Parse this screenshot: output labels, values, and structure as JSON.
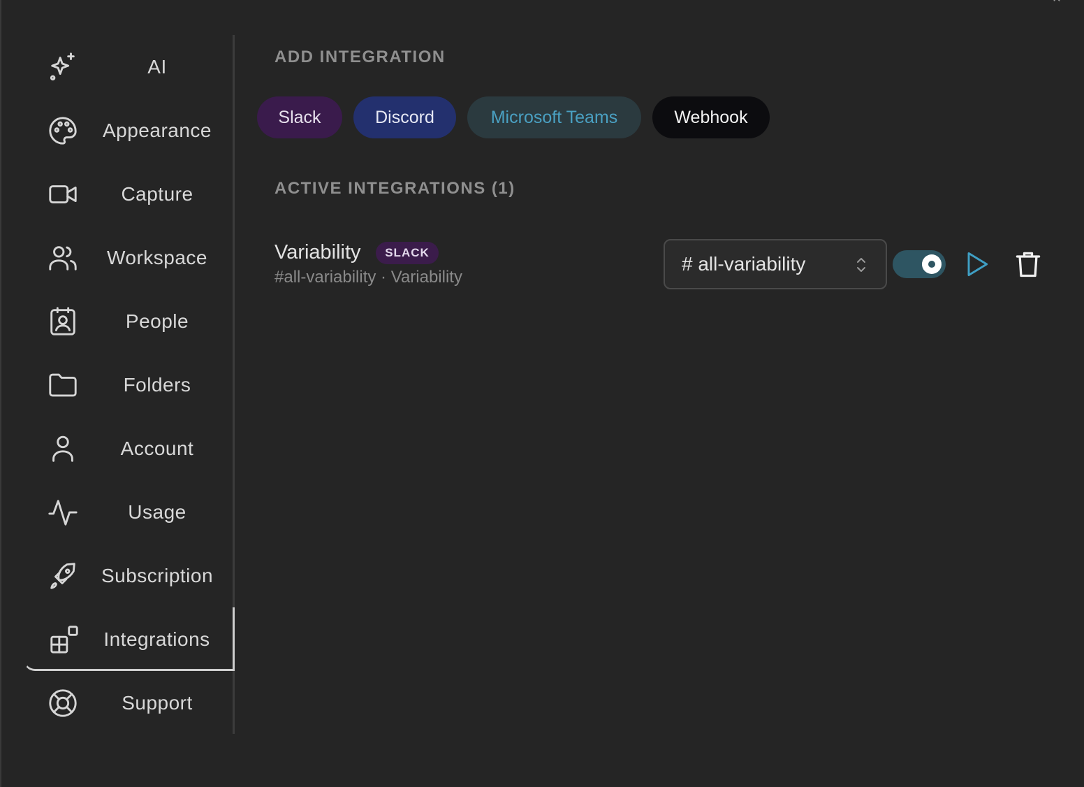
{
  "sidebar": {
    "items": [
      {
        "label": "AI",
        "icon": "sparkles-icon"
      },
      {
        "label": "Appearance",
        "icon": "palette-icon"
      },
      {
        "label": "Capture",
        "icon": "video-camera-icon"
      },
      {
        "label": "Workspace",
        "icon": "users-icon"
      },
      {
        "label": "People",
        "icon": "contact-badge-icon"
      },
      {
        "label": "Folders",
        "icon": "folder-icon"
      },
      {
        "label": "Account",
        "icon": "user-icon"
      },
      {
        "label": "Usage",
        "icon": "activity-pulse-icon"
      },
      {
        "label": "Subscription",
        "icon": "rocket-icon"
      },
      {
        "label": "Integrations",
        "icon": "integrations-blocks-icon",
        "active": true
      },
      {
        "label": "Support",
        "icon": "lifebuoy-icon"
      }
    ]
  },
  "add_integration": {
    "title": "ADD INTEGRATION",
    "options": {
      "slack": "Slack",
      "discord": "Discord",
      "teams": "Microsoft Teams",
      "webhook": "Webhook"
    }
  },
  "active_integrations": {
    "title": "ACTIVE INTEGRATIONS (1)",
    "items": [
      {
        "name": "Variability",
        "badge": "SLACK",
        "subtitle": "#all-variability · Variability",
        "channel": "# all-variability",
        "enabled": true
      }
    ]
  },
  "colors": {
    "background": "#252525",
    "slack": "#3a1b4c",
    "discord": "#23306e",
    "teams_bg": "#2b3a3f",
    "teams_text": "#4aa0c2",
    "webhook": "#0c0c0f",
    "toggle_on": "#2e5562",
    "play_accent": "#3f9fc4"
  }
}
